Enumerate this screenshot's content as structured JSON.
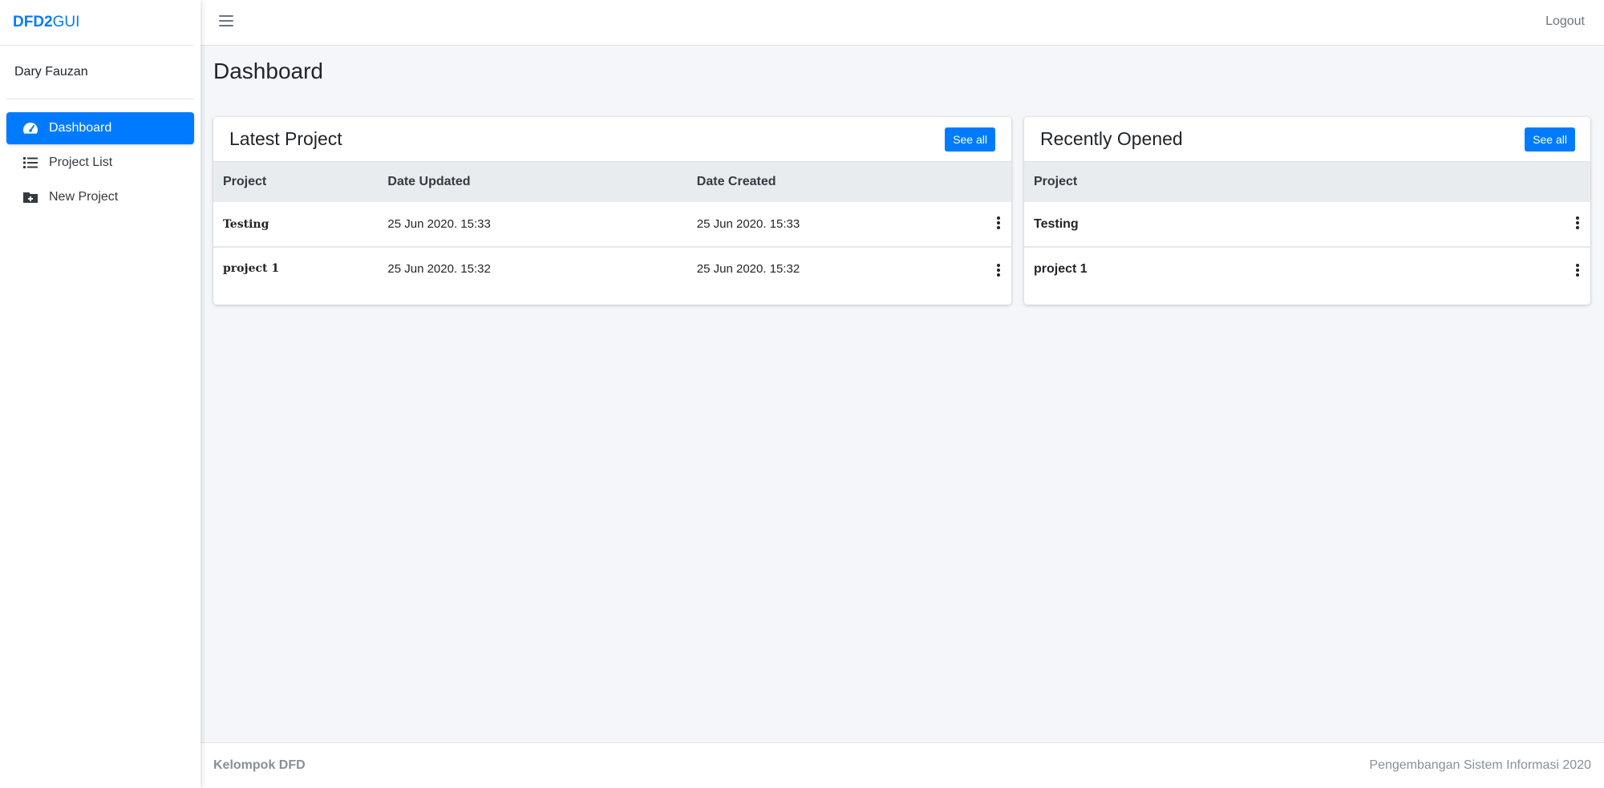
{
  "brand": {
    "part1": "DFD2",
    "part2": "GUI"
  },
  "user": {
    "name": "Dary Fauzan"
  },
  "sidebar": {
    "items": [
      {
        "label": "Dashboard",
        "icon": "tachometer-icon",
        "active": true
      },
      {
        "label": "Project List",
        "icon": "list-icon",
        "active": false
      },
      {
        "label": "New Project",
        "icon": "folder-plus-icon",
        "active": false
      }
    ]
  },
  "topbar": {
    "logout": "Logout"
  },
  "page": {
    "title": "Dashboard"
  },
  "latest": {
    "title": "Latest Project",
    "see_all": "See all",
    "columns": [
      "Project",
      "Date Updated",
      "Date Created"
    ],
    "rows": [
      {
        "project": "Testing",
        "updated": "25 Jun 2020. 15:33",
        "created": "25 Jun 2020. 15:33"
      },
      {
        "project": "project 1",
        "updated": "25 Jun 2020. 15:32",
        "created": "25 Jun 2020. 15:32"
      }
    ]
  },
  "recent": {
    "title": "Recently Opened",
    "see_all": "See all",
    "columns": [
      "Project"
    ],
    "rows": [
      {
        "project": "Testing"
      },
      {
        "project": "project 1"
      }
    ]
  },
  "footer": {
    "left": "Kelompok DFD",
    "right": "Pengembangan Sistem Informasi 2020"
  },
  "colors": {
    "accent": "#007bff",
    "background": "#f4f6f9"
  }
}
